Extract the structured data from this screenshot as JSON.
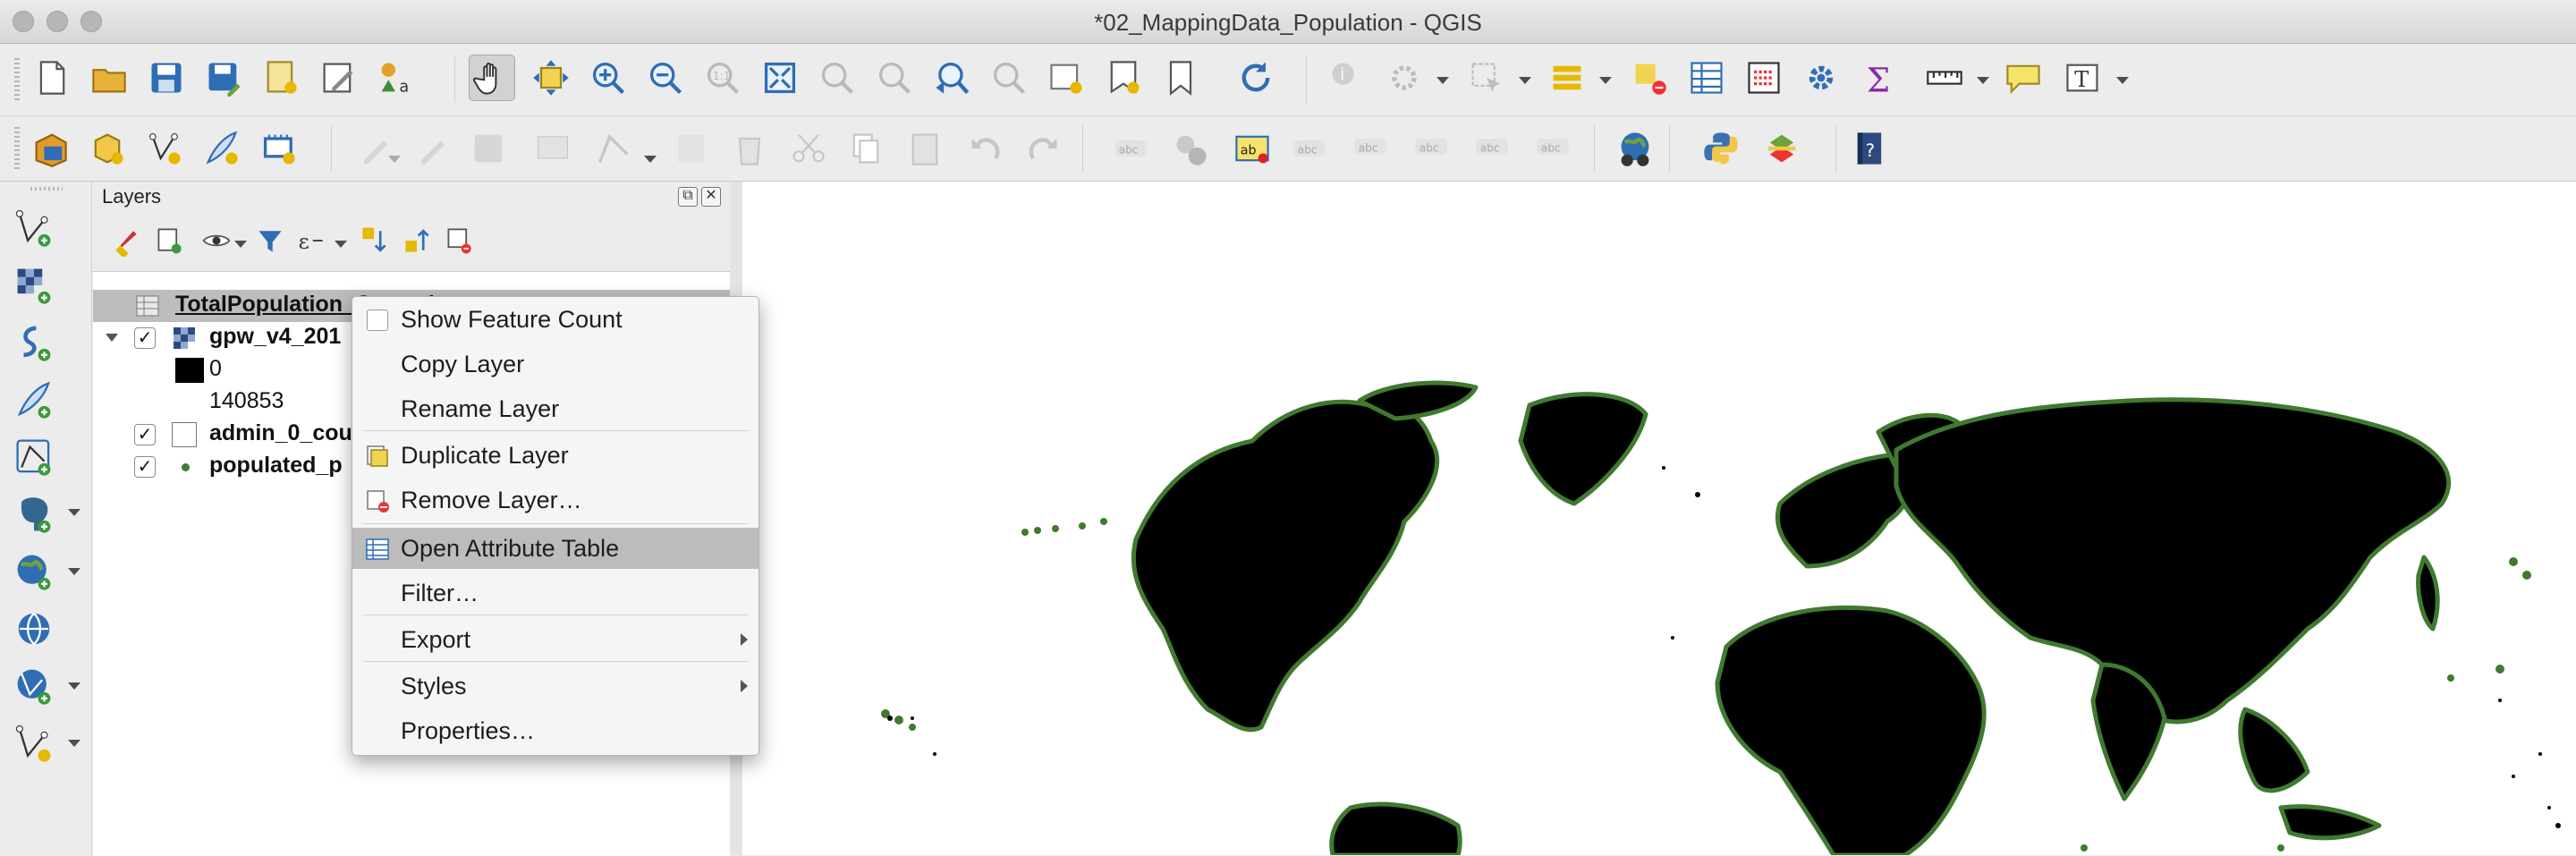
{
  "window": {
    "title": "*02_MappingData_Population - QGIS"
  },
  "layers_panel": {
    "title": "Layers",
    "layers": [
      {
        "name": "TotalPopulation_Countries",
        "selected": true,
        "checked": null
      },
      {
        "name": "gpw_v4_201",
        "checked": true,
        "legend": [
          {
            "label": "0"
          },
          {
            "label": "140853"
          }
        ]
      },
      {
        "name": "admin_0_cou",
        "checked": true
      },
      {
        "name": "populated_p",
        "checked": true
      }
    ]
  },
  "context_menu": {
    "items": [
      {
        "label": "Show Feature Count",
        "type": "checkbox"
      },
      {
        "label": "Copy Layer"
      },
      {
        "label": "Rename Layer"
      },
      {
        "label": "Duplicate Layer",
        "icon": "duplicate-layer-icon"
      },
      {
        "label": "Remove Layer…",
        "icon": "remove-layer-icon"
      },
      {
        "label": "Open Attribute Table",
        "icon": "attribute-table-icon",
        "highlighted": true
      },
      {
        "label": "Filter…"
      },
      {
        "label": "Export",
        "submenu": true
      },
      {
        "label": "Styles",
        "submenu": true
      },
      {
        "label": "Properties…"
      }
    ]
  },
  "colors": {
    "map_land": "#000000",
    "map_coast": "#3f7a2f",
    "menu_highlight": "#bcbcbc",
    "selected_layer": "#bdbdbd"
  }
}
